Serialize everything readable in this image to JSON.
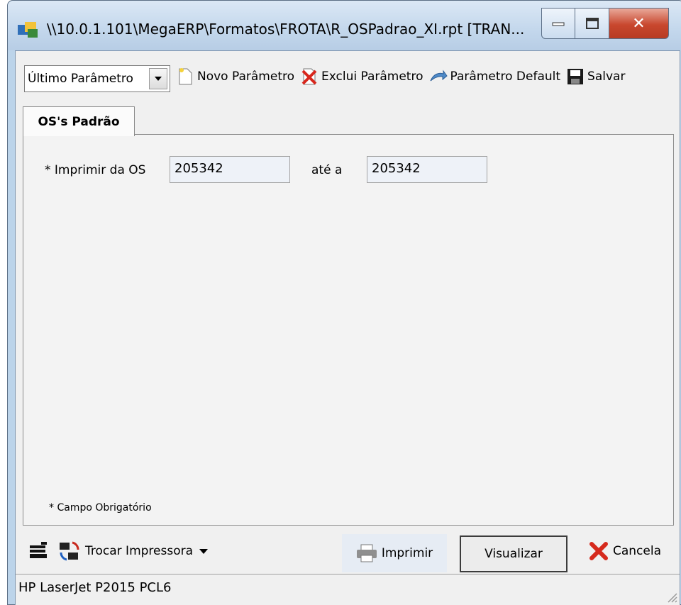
{
  "window": {
    "title": "\\\\10.0.1.101\\MegaERP\\Formatos\\FROTA\\R_OSPadrao_XI.rpt [TRAN..."
  },
  "toolbar": {
    "parameter_select": "Último Parâmetro",
    "new_param": "Novo Parâmetro",
    "delete_param": "Exclui Parâmetro",
    "default_param": "Parâmetro Default",
    "save": "Salvar"
  },
  "tabs": [
    {
      "label": "OS's Padrão"
    }
  ],
  "form": {
    "from_label": "* Imprimir da OS",
    "from_value": "205342",
    "to_label": "até a",
    "to_value": "205342",
    "required_note": "* Campo Obrigatório"
  },
  "actions": {
    "change_printer": "Trocar Impressora",
    "print": "Imprimir",
    "preview": "Visualizar",
    "cancel": "Cancela"
  },
  "status": {
    "printer": "HP LaserJet P2015 PCL6"
  }
}
